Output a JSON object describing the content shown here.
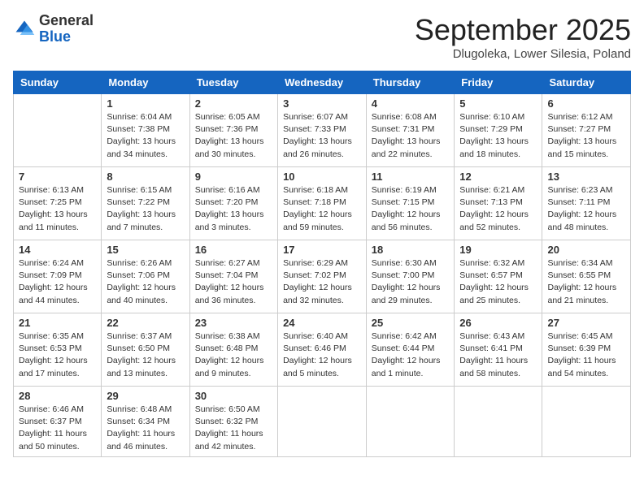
{
  "header": {
    "logo_general": "General",
    "logo_blue": "Blue",
    "month_title": "September 2025",
    "location": "Dlugoleka, Lower Silesia, Poland"
  },
  "weekdays": [
    "Sunday",
    "Monday",
    "Tuesday",
    "Wednesday",
    "Thursday",
    "Friday",
    "Saturday"
  ],
  "weeks": [
    [
      {
        "day": "",
        "info": ""
      },
      {
        "day": "1",
        "info": "Sunrise: 6:04 AM\nSunset: 7:38 PM\nDaylight: 13 hours\nand 34 minutes."
      },
      {
        "day": "2",
        "info": "Sunrise: 6:05 AM\nSunset: 7:36 PM\nDaylight: 13 hours\nand 30 minutes."
      },
      {
        "day": "3",
        "info": "Sunrise: 6:07 AM\nSunset: 7:33 PM\nDaylight: 13 hours\nand 26 minutes."
      },
      {
        "day": "4",
        "info": "Sunrise: 6:08 AM\nSunset: 7:31 PM\nDaylight: 13 hours\nand 22 minutes."
      },
      {
        "day": "5",
        "info": "Sunrise: 6:10 AM\nSunset: 7:29 PM\nDaylight: 13 hours\nand 18 minutes."
      },
      {
        "day": "6",
        "info": "Sunrise: 6:12 AM\nSunset: 7:27 PM\nDaylight: 13 hours\nand 15 minutes."
      }
    ],
    [
      {
        "day": "7",
        "info": "Sunrise: 6:13 AM\nSunset: 7:25 PM\nDaylight: 13 hours\nand 11 minutes."
      },
      {
        "day": "8",
        "info": "Sunrise: 6:15 AM\nSunset: 7:22 PM\nDaylight: 13 hours\nand 7 minutes."
      },
      {
        "day": "9",
        "info": "Sunrise: 6:16 AM\nSunset: 7:20 PM\nDaylight: 13 hours\nand 3 minutes."
      },
      {
        "day": "10",
        "info": "Sunrise: 6:18 AM\nSunset: 7:18 PM\nDaylight: 12 hours\nand 59 minutes."
      },
      {
        "day": "11",
        "info": "Sunrise: 6:19 AM\nSunset: 7:15 PM\nDaylight: 12 hours\nand 56 minutes."
      },
      {
        "day": "12",
        "info": "Sunrise: 6:21 AM\nSunset: 7:13 PM\nDaylight: 12 hours\nand 52 minutes."
      },
      {
        "day": "13",
        "info": "Sunrise: 6:23 AM\nSunset: 7:11 PM\nDaylight: 12 hours\nand 48 minutes."
      }
    ],
    [
      {
        "day": "14",
        "info": "Sunrise: 6:24 AM\nSunset: 7:09 PM\nDaylight: 12 hours\nand 44 minutes."
      },
      {
        "day": "15",
        "info": "Sunrise: 6:26 AM\nSunset: 7:06 PM\nDaylight: 12 hours\nand 40 minutes."
      },
      {
        "day": "16",
        "info": "Sunrise: 6:27 AM\nSunset: 7:04 PM\nDaylight: 12 hours\nand 36 minutes."
      },
      {
        "day": "17",
        "info": "Sunrise: 6:29 AM\nSunset: 7:02 PM\nDaylight: 12 hours\nand 32 minutes."
      },
      {
        "day": "18",
        "info": "Sunrise: 6:30 AM\nSunset: 7:00 PM\nDaylight: 12 hours\nand 29 minutes."
      },
      {
        "day": "19",
        "info": "Sunrise: 6:32 AM\nSunset: 6:57 PM\nDaylight: 12 hours\nand 25 minutes."
      },
      {
        "day": "20",
        "info": "Sunrise: 6:34 AM\nSunset: 6:55 PM\nDaylight: 12 hours\nand 21 minutes."
      }
    ],
    [
      {
        "day": "21",
        "info": "Sunrise: 6:35 AM\nSunset: 6:53 PM\nDaylight: 12 hours\nand 17 minutes."
      },
      {
        "day": "22",
        "info": "Sunrise: 6:37 AM\nSunset: 6:50 PM\nDaylight: 12 hours\nand 13 minutes."
      },
      {
        "day": "23",
        "info": "Sunrise: 6:38 AM\nSunset: 6:48 PM\nDaylight: 12 hours\nand 9 minutes."
      },
      {
        "day": "24",
        "info": "Sunrise: 6:40 AM\nSunset: 6:46 PM\nDaylight: 12 hours\nand 5 minutes."
      },
      {
        "day": "25",
        "info": "Sunrise: 6:42 AM\nSunset: 6:44 PM\nDaylight: 12 hours\nand 1 minute."
      },
      {
        "day": "26",
        "info": "Sunrise: 6:43 AM\nSunset: 6:41 PM\nDaylight: 11 hours\nand 58 minutes."
      },
      {
        "day": "27",
        "info": "Sunrise: 6:45 AM\nSunset: 6:39 PM\nDaylight: 11 hours\nand 54 minutes."
      }
    ],
    [
      {
        "day": "28",
        "info": "Sunrise: 6:46 AM\nSunset: 6:37 PM\nDaylight: 11 hours\nand 50 minutes."
      },
      {
        "day": "29",
        "info": "Sunrise: 6:48 AM\nSunset: 6:34 PM\nDaylight: 11 hours\nand 46 minutes."
      },
      {
        "day": "30",
        "info": "Sunrise: 6:50 AM\nSunset: 6:32 PM\nDaylight: 11 hours\nand 42 minutes."
      },
      {
        "day": "",
        "info": ""
      },
      {
        "day": "",
        "info": ""
      },
      {
        "day": "",
        "info": ""
      },
      {
        "day": "",
        "info": ""
      }
    ]
  ]
}
